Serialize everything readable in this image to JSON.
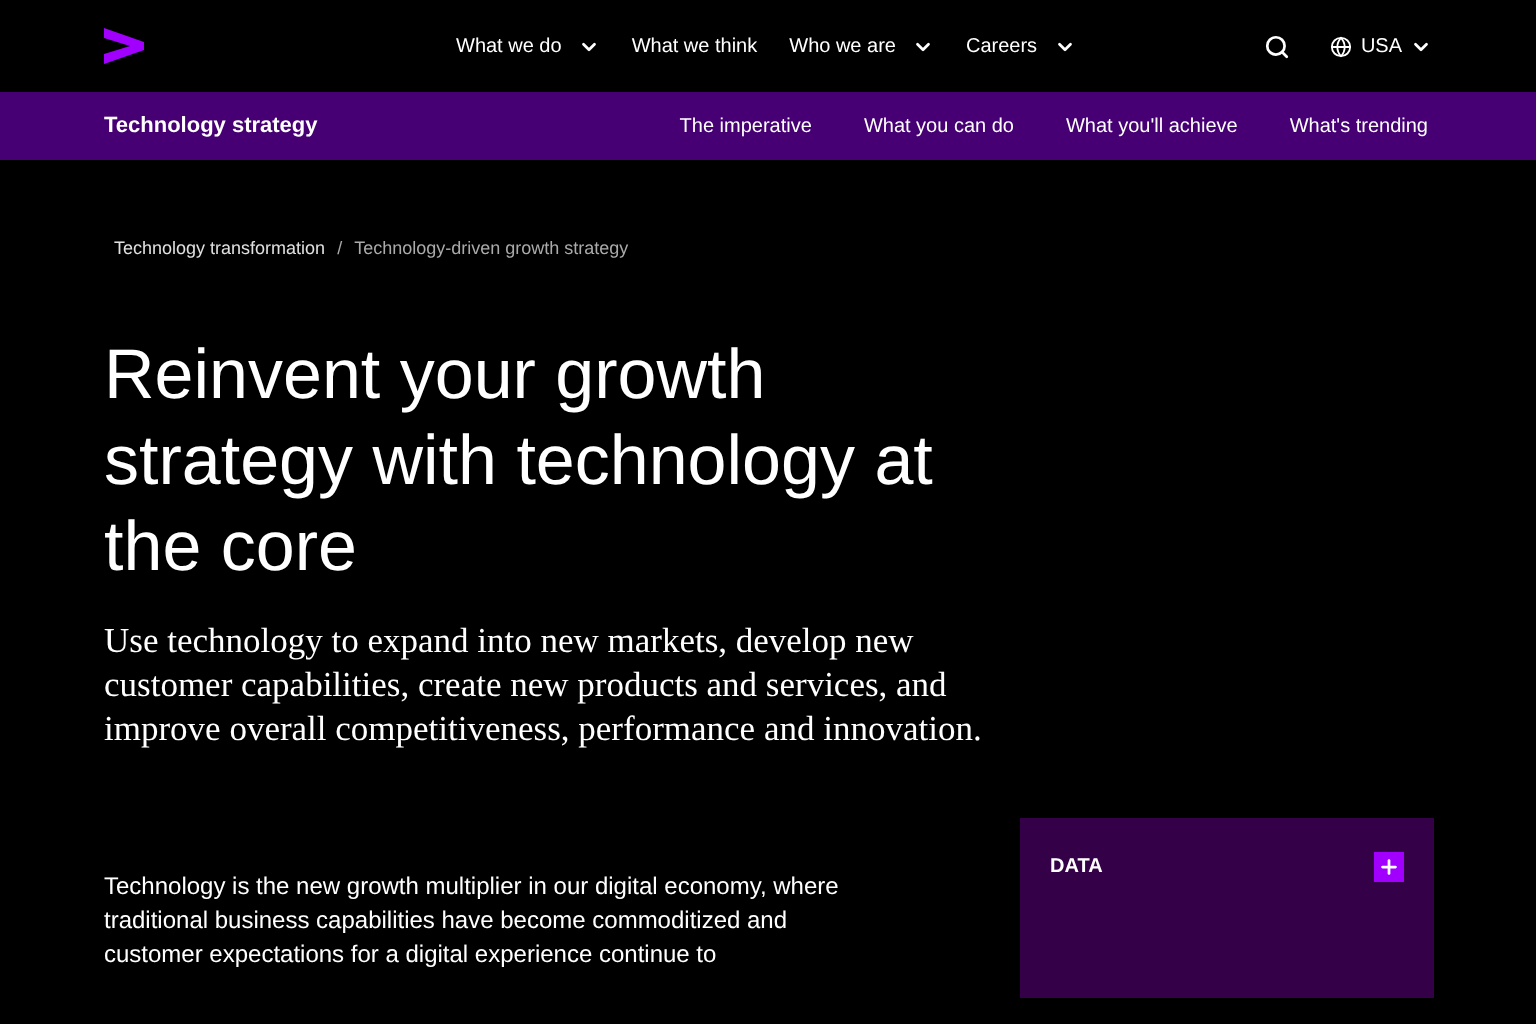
{
  "nav": {
    "items": [
      {
        "label": "What we do",
        "dropdown": true
      },
      {
        "label": "What we think",
        "dropdown": false
      },
      {
        "label": "Who we are",
        "dropdown": true
      },
      {
        "label": "Careers",
        "dropdown": true
      }
    ],
    "region": "USA"
  },
  "subnav": {
    "title": "Technology strategy",
    "links": [
      "The imperative",
      "What you can do",
      "What you'll achieve",
      "What's trending"
    ]
  },
  "breadcrumb": [
    "Technology transformation",
    "/",
    "Technology-driven growth strategy"
  ],
  "headline": "Reinvent your growth strategy with technology at the core",
  "subhead": "Use technology to expand into new markets, develop new customer capabilities, create new products and services, and improve overall competitiveness, performance and innovation.",
  "body": "Technology is the new growth multiplier in our digital economy, where traditional business capabilities have become commoditized and customer expectations for a digital experience continue to",
  "card": {
    "label": "DATA"
  }
}
